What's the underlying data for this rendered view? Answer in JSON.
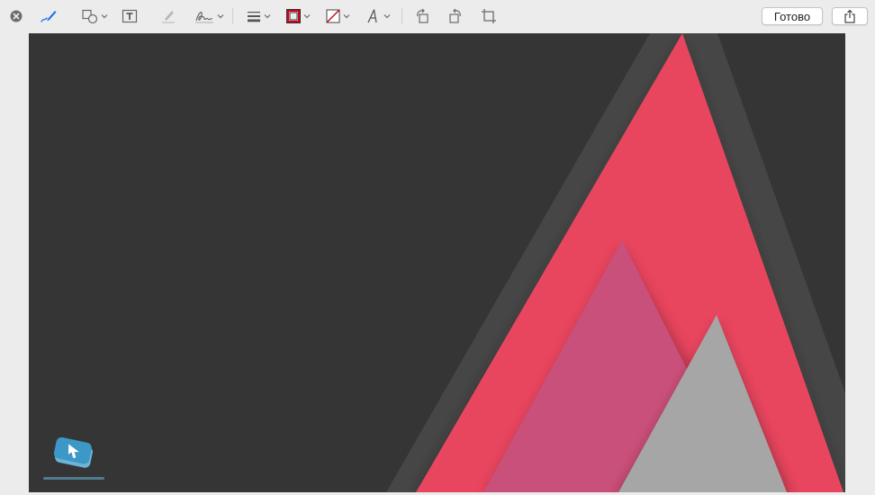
{
  "toolbar": {
    "close": {
      "icon": "close-circle-icon"
    },
    "tools": [
      {
        "name": "sketch-tool",
        "icon": "pen-sketch-icon"
      },
      {
        "name": "shapes-tool",
        "icon": "shapes-icon"
      },
      {
        "name": "text-tool",
        "icon": "text-box-icon"
      },
      {
        "name": "highlight-tool",
        "icon": "highlighter-icon"
      },
      {
        "name": "sign-tool",
        "icon": "signature-icon"
      },
      {
        "name": "line-style-tool",
        "icon": "line-style-icon"
      },
      {
        "name": "border-color-tool",
        "icon": "border-color-icon",
        "color": "#d0021b"
      },
      {
        "name": "fill-color-tool",
        "icon": "fill-color-icon",
        "color": "#d0021b"
      },
      {
        "name": "text-style-tool",
        "icon": "text-style-icon"
      },
      {
        "name": "rotate-left-tool",
        "icon": "rotate-left-icon"
      },
      {
        "name": "rotate-right-tool",
        "icon": "rotate-right-icon"
      },
      {
        "name": "crop-tool",
        "icon": "crop-icon"
      }
    ],
    "done_label": "Готово",
    "share": {
      "icon": "share-icon"
    }
  },
  "canvas": {
    "background": "#353535",
    "colors": {
      "shadow_triangle": "#464646",
      "big_triangle": "#e8465e",
      "pink_triangle": "#c9507a",
      "gray_triangle": "#a6a6a6"
    },
    "watermark": {
      "icon": "mobile-review-logo-icon"
    }
  }
}
